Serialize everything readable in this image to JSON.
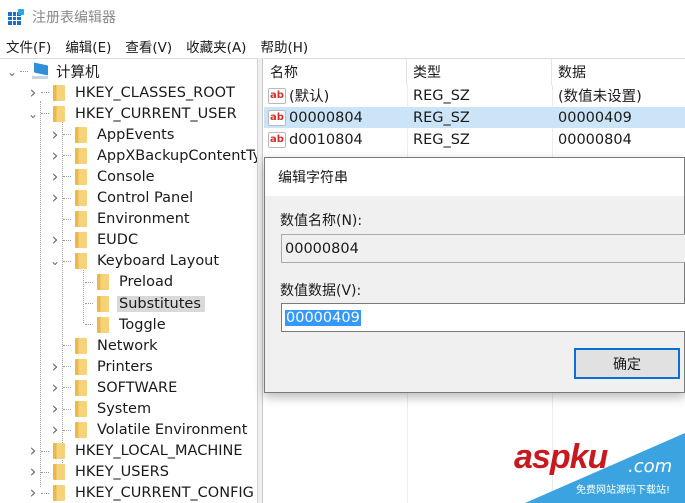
{
  "window": {
    "title": "注册表编辑器",
    "app_icon": "registry-editor-icon"
  },
  "menubar": [
    {
      "label": "文件(F)"
    },
    {
      "label": "编辑(E)"
    },
    {
      "label": "查看(V)"
    },
    {
      "label": "收藏夹(A)"
    },
    {
      "label": "帮助(H)"
    }
  ],
  "tree": {
    "root": {
      "label": "计算机",
      "icon": "computer-icon",
      "expanded": true
    },
    "items": [
      {
        "label": "HKEY_CLASSES_ROOT",
        "level": 1,
        "expander": "collapsed"
      },
      {
        "label": "HKEY_CURRENT_USER",
        "level": 1,
        "expander": "expanded"
      },
      {
        "label": "AppEvents",
        "level": 2,
        "expander": "collapsed"
      },
      {
        "label": "AppXBackupContentTy",
        "level": 2,
        "expander": "collapsed"
      },
      {
        "label": "Console",
        "level": 2,
        "expander": "collapsed"
      },
      {
        "label": "Control Panel",
        "level": 2,
        "expander": "collapsed"
      },
      {
        "label": "Environment",
        "level": 2,
        "expander": "none"
      },
      {
        "label": "EUDC",
        "level": 2,
        "expander": "collapsed"
      },
      {
        "label": "Keyboard Layout",
        "level": 2,
        "expander": "expanded"
      },
      {
        "label": "Preload",
        "level": 3,
        "expander": "none"
      },
      {
        "label": "Substitutes",
        "level": 3,
        "expander": "none",
        "selected": true
      },
      {
        "label": "Toggle",
        "level": 3,
        "expander": "none"
      },
      {
        "label": "Network",
        "level": 2,
        "expander": "none"
      },
      {
        "label": "Printers",
        "level": 2,
        "expander": "collapsed"
      },
      {
        "label": "SOFTWARE",
        "level": 2,
        "expander": "collapsed"
      },
      {
        "label": "System",
        "level": 2,
        "expander": "collapsed"
      },
      {
        "label": "Volatile Environment",
        "level": 2,
        "expander": "collapsed"
      },
      {
        "label": "HKEY_LOCAL_MACHINE",
        "level": 1,
        "expander": "collapsed"
      },
      {
        "label": "HKEY_USERS",
        "level": 1,
        "expander": "collapsed"
      },
      {
        "label": "HKEY_CURRENT_CONFIG",
        "level": 1,
        "expander": "collapsed"
      }
    ]
  },
  "values_list": {
    "columns": [
      "名称",
      "类型",
      "数据"
    ],
    "rows": [
      {
        "icon": "ab",
        "name": "(默认)",
        "type": "REG_SZ",
        "data": "(数值未设置)"
      },
      {
        "icon": "ab",
        "name": "00000804",
        "type": "REG_SZ",
        "data": "00000409",
        "selected": true
      },
      {
        "icon": "ab",
        "name": "d0010804",
        "type": "REG_SZ",
        "data": "00000804"
      }
    ]
  },
  "dialog": {
    "title": "编辑字符串",
    "name_label": "数值名称(N):",
    "name_value": "00000804",
    "data_label": "数值数据(V):",
    "data_value": "00000409",
    "ok_label": "确定"
  },
  "watermark": {
    "brand": "aspku",
    "suffix": ".com",
    "tagline": "免费网站源码下载站!"
  }
}
